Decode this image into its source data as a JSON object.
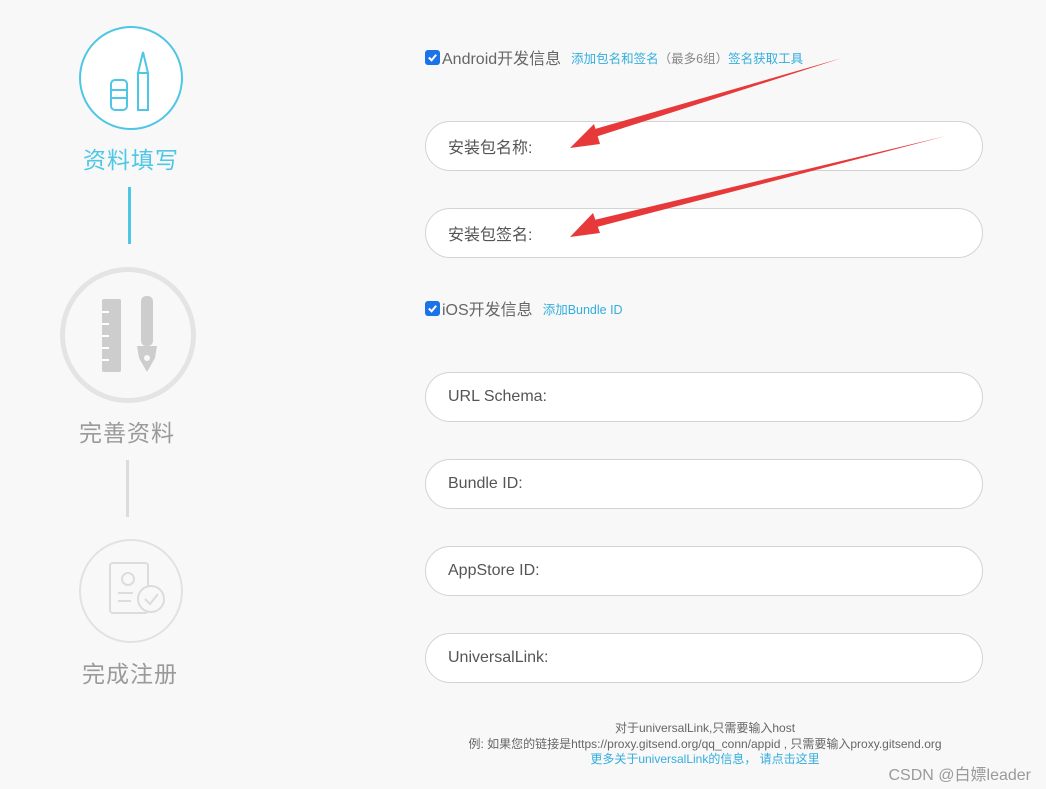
{
  "steps": [
    {
      "label": "资料填写",
      "state": "active",
      "icon": "pencil-icon"
    },
    {
      "label": "完善资料",
      "state": "pending",
      "icon": "ruler-pen-icon"
    },
    {
      "label": "完成注册",
      "state": "pending",
      "icon": "document-check-icon"
    }
  ],
  "android": {
    "checked": true,
    "title": "Android开发信息",
    "add_link": "添加包名和签名",
    "limit_text": "（最多6组）",
    "tool_link": "签名获取工具",
    "package_name_label": "安装包名称:",
    "signature_label": "安装包签名:"
  },
  "ios": {
    "checked": true,
    "title": "iOS开发信息",
    "add_link": "添加Bundle ID",
    "url_schema_label": "URL Schema:",
    "bundle_id_label": "Bundle ID:",
    "appstore_id_label": "AppStore ID:",
    "universal_link_label": "UniversalLink:"
  },
  "note": {
    "line1": "对于universalLink,只需要输入host",
    "line2": "例: 如果您的链接是https://proxy.gitsend.org/qq_conn/appid , 只需要输入proxy.gitsend.org",
    "line3": "更多关于universalLink的信息， 请点击这里"
  },
  "watermark": "CSDN @白嫖leader",
  "colors": {
    "accent": "#4ec6e6",
    "link": "#33aedd",
    "arrow": "#e8393a",
    "checkbox": "#1a73e8"
  }
}
